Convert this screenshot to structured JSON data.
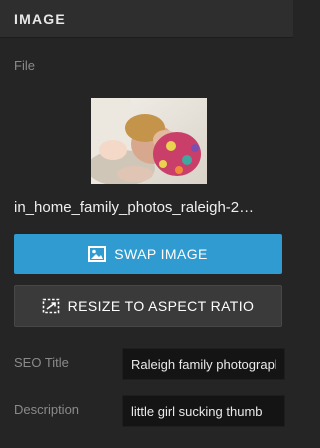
{
  "header": {
    "title": "IMAGE"
  },
  "file": {
    "label": "File",
    "thumbnail_icon": "photo-thumbnail",
    "filename": "in_home_family_photos_raleigh-2…"
  },
  "buttons": {
    "swap_label": "SWAP IMAGE",
    "swap_icon": "image-icon",
    "resize_label": "RESIZE TO ASPECT RATIO",
    "resize_icon": "resize-icon"
  },
  "fields": {
    "seo_title_label": "SEO Title",
    "seo_title_value": "Raleigh family photographer",
    "description_label": "Description",
    "description_value": "little girl sucking thumb"
  },
  "colors": {
    "background": "#252525",
    "header": "#2e2e2e",
    "accent": "#2f9bd0",
    "secondary_button": "#3a3a3a",
    "input": "#141414"
  }
}
